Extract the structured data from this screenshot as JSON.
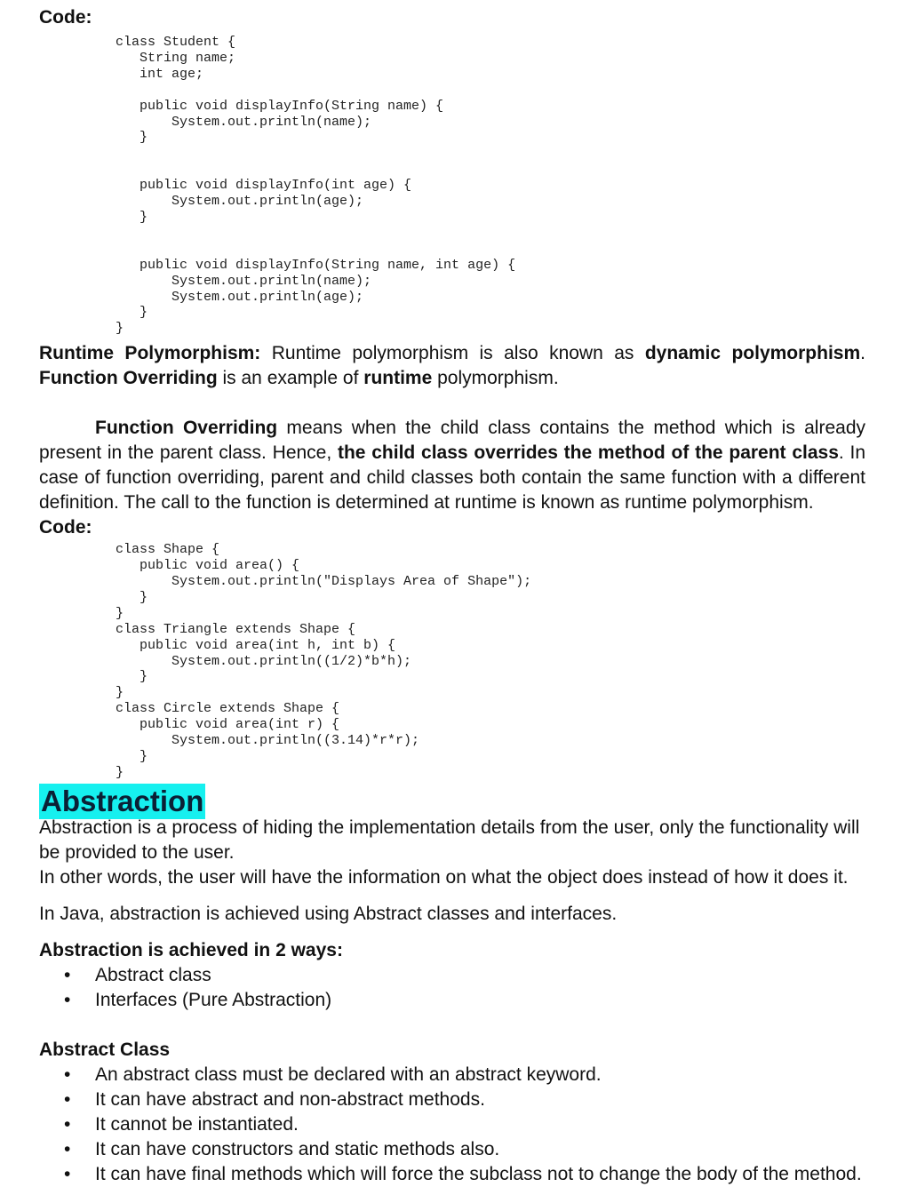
{
  "section1": {
    "code_label": "Code:",
    "code": "class Student {\n   String name;\n   int age;\n\n   public void displayInfo(String name) {\n       System.out.println(name);\n   }\n\n\n   public void displayInfo(int age) {\n       System.out.println(age);\n   }\n\n\n   public void displayInfo(String name, int age) {\n       System.out.println(name);\n       System.out.println(age);\n   }\n}"
  },
  "runtime": {
    "term": "Runtime Polymorphism:",
    "text1": " Runtime polymorphism is also known as ",
    "bold1": "dynamic polymorphism",
    "text2": ". ",
    "bold2": "Function Overriding",
    "text3": " is an example of ",
    "bold3": "runtime",
    "text4": " polymorphism."
  },
  "overriding": {
    "term": "Function Overriding",
    "text1": " means when the child class contains the method which is already present in the parent class. Hence, ",
    "bold1": "the child class overrides the method of the parent class",
    "text2": ". In case of function overriding, parent and child classes both contain the same function with a different definition. The call to the function is determined at runtime is known as runtime polymorphism."
  },
  "section2": {
    "code_label": "Code:",
    "code": "class Shape {\n   public void area() {\n       System.out.println(\"Displays Area of Shape\");\n   }\n}\nclass Triangle extends Shape {\n   public void area(int h, int b) {\n       System.out.println((1/2)*b*h);\n   }\n}\nclass Circle extends Shape {\n   public void area(int r) {\n       System.out.println((3.14)*r*r);\n   }\n}"
  },
  "abstraction": {
    "heading": "Abstraction",
    "p1": "Abstraction is a process of hiding the implementation details from the user, only the functionality will be provided to the user.",
    "p2": "In other words, the user will have the information on what the object does instead of how it does it.",
    "p3": "In Java, abstraction is achieved using Abstract classes and interfaces.",
    "ways_heading": "Abstraction is achieved in 2 ways:",
    "ways": [
      "Abstract class",
      "Interfaces (Pure Abstraction)"
    ],
    "abstract_class_heading": "Abstract Class",
    "abstract_class_points": [
      "An abstract class must be declared with an abstract keyword.",
      "It can have abstract and non-abstract methods.",
      "It cannot be instantiated.",
      "It can have constructors and static methods also.",
      "It can have final methods which will force the subclass not to change the body of the method."
    ]
  }
}
